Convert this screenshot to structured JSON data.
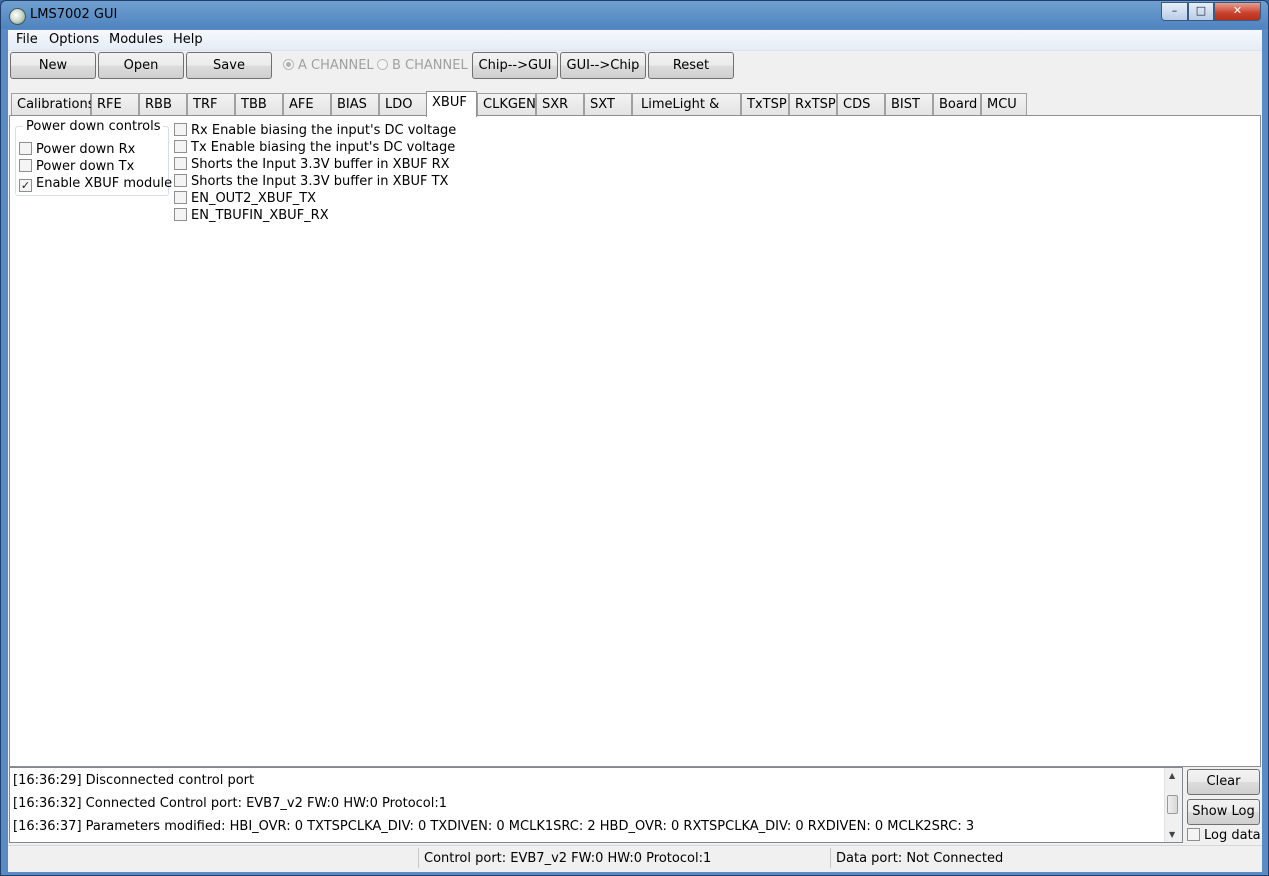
{
  "window": {
    "title": "LMS7002 GUI",
    "min_glyph": "–",
    "max_glyph": "□",
    "close_glyph": "✕"
  },
  "menu": [
    "File",
    "Options",
    "Modules",
    "Help"
  ],
  "toolbar": {
    "new_label": "New",
    "open_label": "Open",
    "save_label": "Save",
    "channel_a": "A CHANNEL",
    "channel_b": "B CHANNEL",
    "chip_to_gui": "Chip-->GUI",
    "gui_to_chip": "GUI-->Chip",
    "reset": "Reset"
  },
  "tabs": [
    "Calibrations",
    "RFE",
    "RBB",
    "TRF",
    "TBB",
    "AFE",
    "BIAS",
    "LDO",
    "XBUF",
    "CLKGEN",
    "SXR",
    "SXT",
    "LimeLight & PAD",
    "TxTSP",
    "RxTSP",
    "CDS",
    "BIST",
    "Board",
    "MCU"
  ],
  "active_tab": "XBUF",
  "power_group": {
    "title": "Power down controls",
    "items": [
      {
        "label": "Power down Rx",
        "checked": false
      },
      {
        "label": "Power down Tx",
        "checked": false
      },
      {
        "label": "Enable XBUF module",
        "checked": true
      }
    ]
  },
  "xbuf_options": [
    {
      "label": "Rx Enable biasing the input's DC voltage",
      "checked": false
    },
    {
      "label": "Tx Enable biasing the input's DC voltage",
      "checked": false
    },
    {
      "label": "Shorts the Input 3.3V buffer in XBUF RX",
      "checked": false
    },
    {
      "label": "Shorts the Input 3.3V buffer in XBUF TX",
      "checked": false
    },
    {
      "label": "EN_OUT2_XBUF_TX",
      "checked": false
    },
    {
      "label": "EN_TBUFIN_XBUF_RX",
      "checked": false
    }
  ],
  "log": [
    "[16:36:29] Disconnected control port",
    "[16:36:32] Connected Control port: EVB7_v2 FW:0 HW:0 Protocol:1",
    "[16:36:37] Parameters modified: HBI_OVR: 0 TXTSPCLKA_DIV: 0 TXDIVEN: 0 MCLK1SRC: 2 HBD_OVR: 0 RXTSPCLKA_DIV: 0 RXDIVEN: 0 MCLK2SRC: 3"
  ],
  "log_controls": {
    "clear": "Clear",
    "show_log": "Show Log",
    "log_data": "Log data",
    "log_data_checked": false
  },
  "status": {
    "control_port": "Control port: EVB7_v2 FW:0 HW:0 Protocol:1",
    "data_port": "Data port: Not Connected"
  }
}
